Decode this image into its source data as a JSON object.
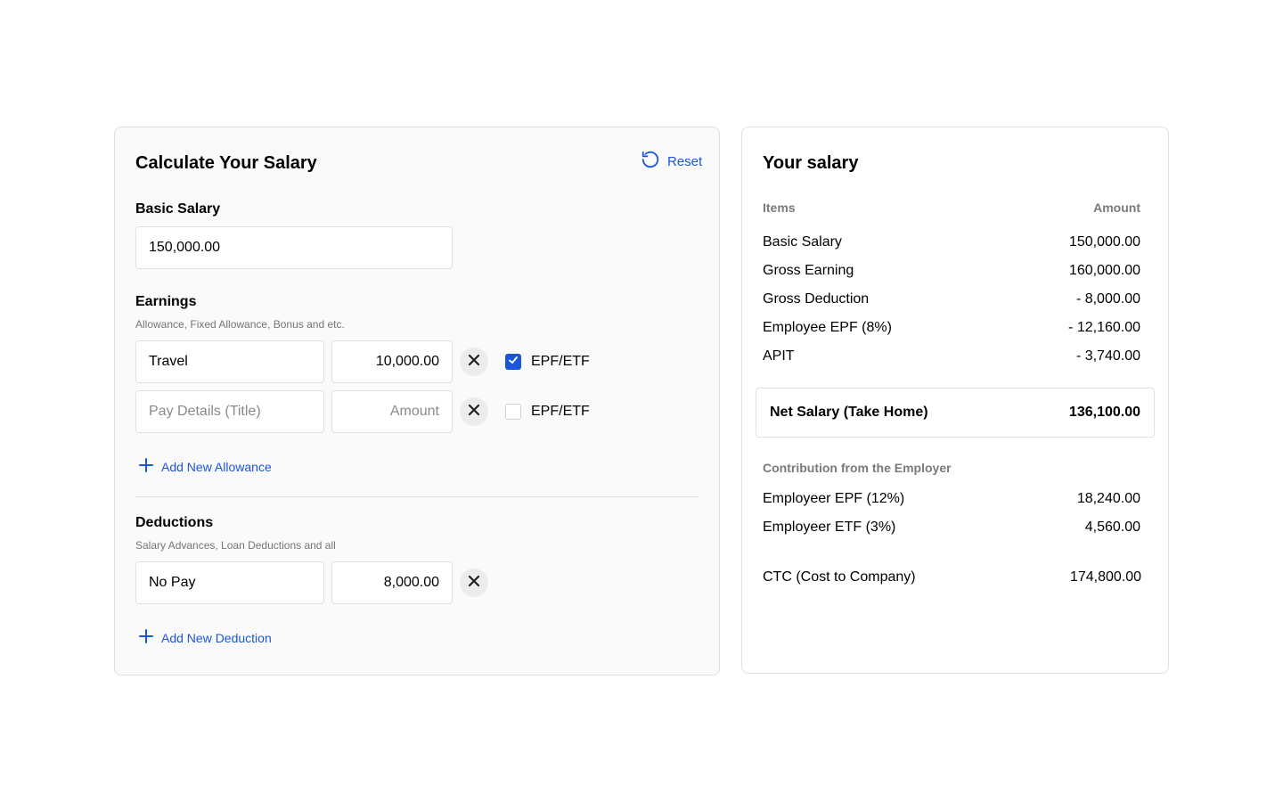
{
  "calculator": {
    "title": "Calculate Your Salary",
    "reset_label": "Reset",
    "basic_salary": {
      "label": "Basic Salary",
      "value": "150,000.00"
    },
    "earnings": {
      "label": "Earnings",
      "hint": "Allowance, Fixed Allowance, Bonus and etc.",
      "rows": [
        {
          "title": "Travel",
          "amount": "10,000.00",
          "epf_label": "EPF/ETF",
          "epf_checked": true
        },
        {
          "title": "",
          "amount": "",
          "epf_label": "EPF/ETF",
          "epf_checked": false
        }
      ],
      "title_placeholder": "Pay Details (Title)",
      "amount_placeholder": "Amount",
      "add_label": "Add New Allowance"
    },
    "deductions": {
      "label": "Deductions",
      "hint": "Salary Advances, Loan Deductions and all",
      "rows": [
        {
          "title": "No Pay",
          "amount": "8,000.00"
        }
      ],
      "add_label": "Add New Deduction"
    }
  },
  "summary": {
    "title": "Your salary",
    "col_items": "Items",
    "col_amount": "Amount",
    "rows": [
      {
        "label": "Basic Salary",
        "value": "150,000.00"
      },
      {
        "label": "Gross Earning",
        "value": "160,000.00"
      },
      {
        "label": "Gross Deduction",
        "value": "- 8,000.00"
      },
      {
        "label": "Employee EPF (8%)",
        "value": "- 12,160.00"
      },
      {
        "label": "APIT",
        "value": "- 3,740.00"
      }
    ],
    "net": {
      "label": "Net Salary (Take Home)",
      "value": "136,100.00"
    },
    "employer_heading": "Contribution from the Employer",
    "employer_rows": [
      {
        "label": "Employeer EPF (12%)",
        "value": "18,240.00"
      },
      {
        "label": "Employeer ETF (3%)",
        "value": "4,560.00"
      }
    ],
    "ctc": {
      "label": "CTC (Cost to Company)",
      "value": "174,800.00"
    }
  },
  "colors": {
    "accent": "#1a56db",
    "muted": "#757575",
    "border": "#e0e0e0",
    "panel": "#fafafa"
  }
}
